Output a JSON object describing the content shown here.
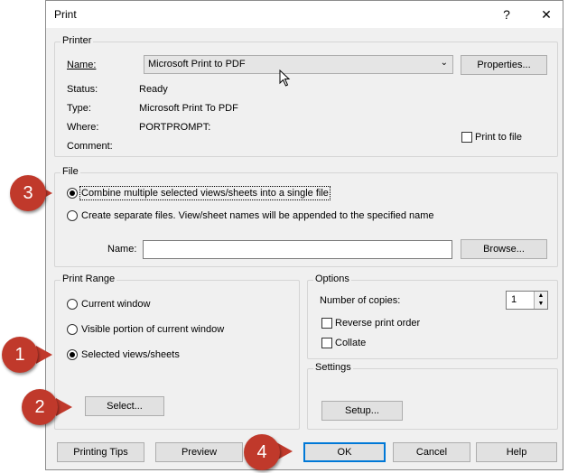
{
  "window": {
    "title": "Print",
    "help": "?",
    "close": "✕"
  },
  "printer": {
    "legend": "Printer",
    "name_label": "Name:",
    "name_value": "Microsoft Print to PDF",
    "properties_button": "Properties...",
    "status_label": "Status:",
    "status_value": "Ready",
    "type_label": "Type:",
    "type_value": "Microsoft Print To PDF",
    "where_label": "Where:",
    "where_value": "PORTPROMPT:",
    "comment_label": "Comment:",
    "print_to_file": "Print to file"
  },
  "file": {
    "legend": "File",
    "combine_option": "Combine multiple selected views/sheets into a single file",
    "separate_option": "Create separate files. View/sheet names will be appended to the specified name",
    "name_label": "Name:",
    "name_value": "",
    "browse_button": "Browse..."
  },
  "print_range": {
    "legend": "Print Range",
    "current_window": "Current window",
    "visible_portion": "Visible portion of current window",
    "selected_views": "Selected views/sheets",
    "select_button": "Select..."
  },
  "options": {
    "legend": "Options",
    "copies_label": "Number of copies:",
    "copies_value": "1",
    "reverse_order": "Reverse print order",
    "collate": "Collate"
  },
  "settings": {
    "legend": "Settings",
    "setup_button": "Setup..."
  },
  "footer": {
    "printing_tips": "Printing Tips",
    "preview": "Preview",
    "ok": "OK",
    "cancel": "Cancel",
    "help": "Help"
  },
  "markers": [
    "1",
    "2",
    "3",
    "4"
  ],
  "colors": {
    "marker": "#c0392b",
    "accent": "#0078d7",
    "dialog_bg": "#f0f0f0"
  }
}
